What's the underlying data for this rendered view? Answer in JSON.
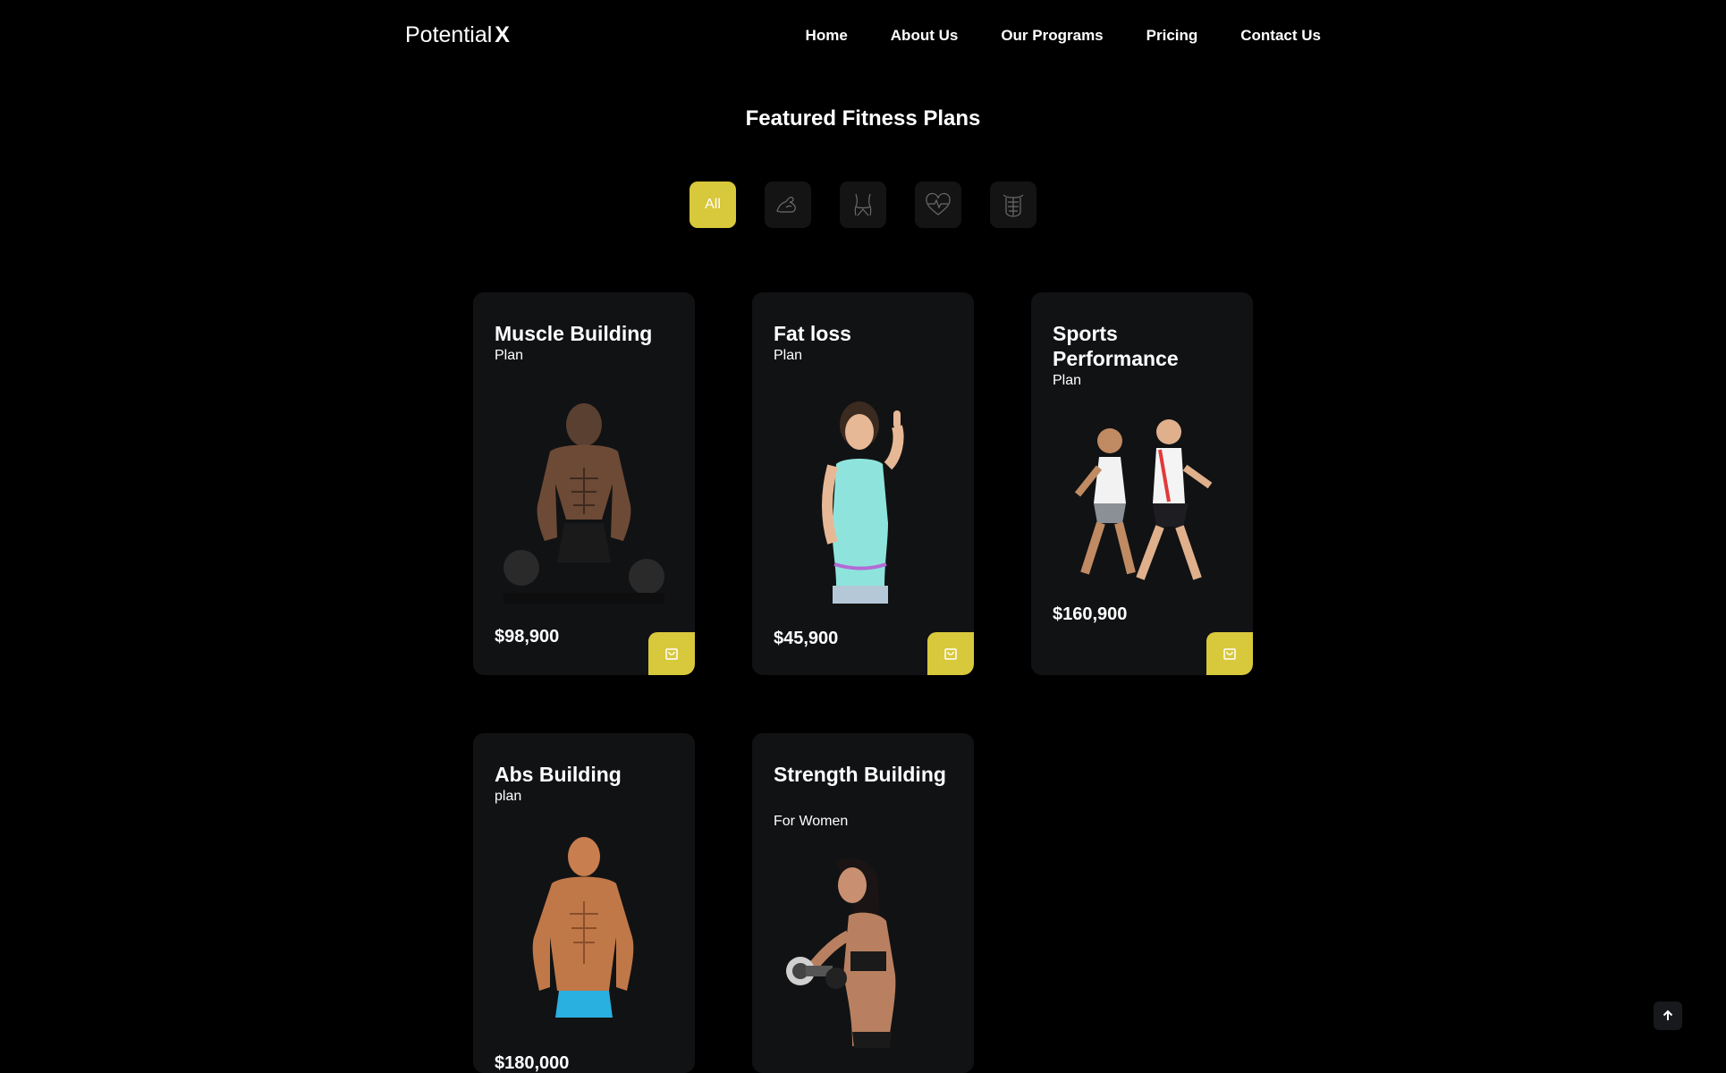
{
  "brand": {
    "name": "Potential",
    "mark": "X"
  },
  "nav": {
    "items": [
      {
        "label": "Home"
      },
      {
        "label": "About Us"
      },
      {
        "label": "Our Programs"
      },
      {
        "label": "Pricing"
      },
      {
        "label": "Contact Us"
      }
    ]
  },
  "section": {
    "title": "Featured Fitness Plans"
  },
  "filters": [
    {
      "label": "All",
      "icon": "",
      "active": true
    },
    {
      "label": "",
      "icon": "bicep-icon",
      "active": false
    },
    {
      "label": "",
      "icon": "waist-icon",
      "active": false
    },
    {
      "label": "",
      "icon": "heart-pulse-icon",
      "active": false
    },
    {
      "label": "",
      "icon": "abs-icon",
      "active": false
    }
  ],
  "plans": [
    {
      "title": "Muscle Building",
      "subtitle": "Plan",
      "price": "$98,900",
      "image": "muscular man with dumbbells"
    },
    {
      "title": "Fat loss",
      "subtitle": "Plan",
      "price": "$45,900",
      "image": "smiling woman measuring waist"
    },
    {
      "title": "Sports Performance",
      "subtitle": "Plan",
      "price": "$160,900",
      "image": "two runners"
    },
    {
      "title": "Abs Building",
      "subtitle": "plan",
      "price": "$180,000",
      "image": "shirtless man in blue shorts"
    },
    {
      "title": "Strength Building",
      "subtitle": "For Women",
      "price": "",
      "image": "woman curling dumbbell"
    }
  ],
  "colors": {
    "accent": "#d8c83b",
    "background": "#000000",
    "card": "#111214"
  },
  "icons": {
    "cart": "shopping-bag-icon",
    "scroll_top": "arrow-up-icon"
  }
}
